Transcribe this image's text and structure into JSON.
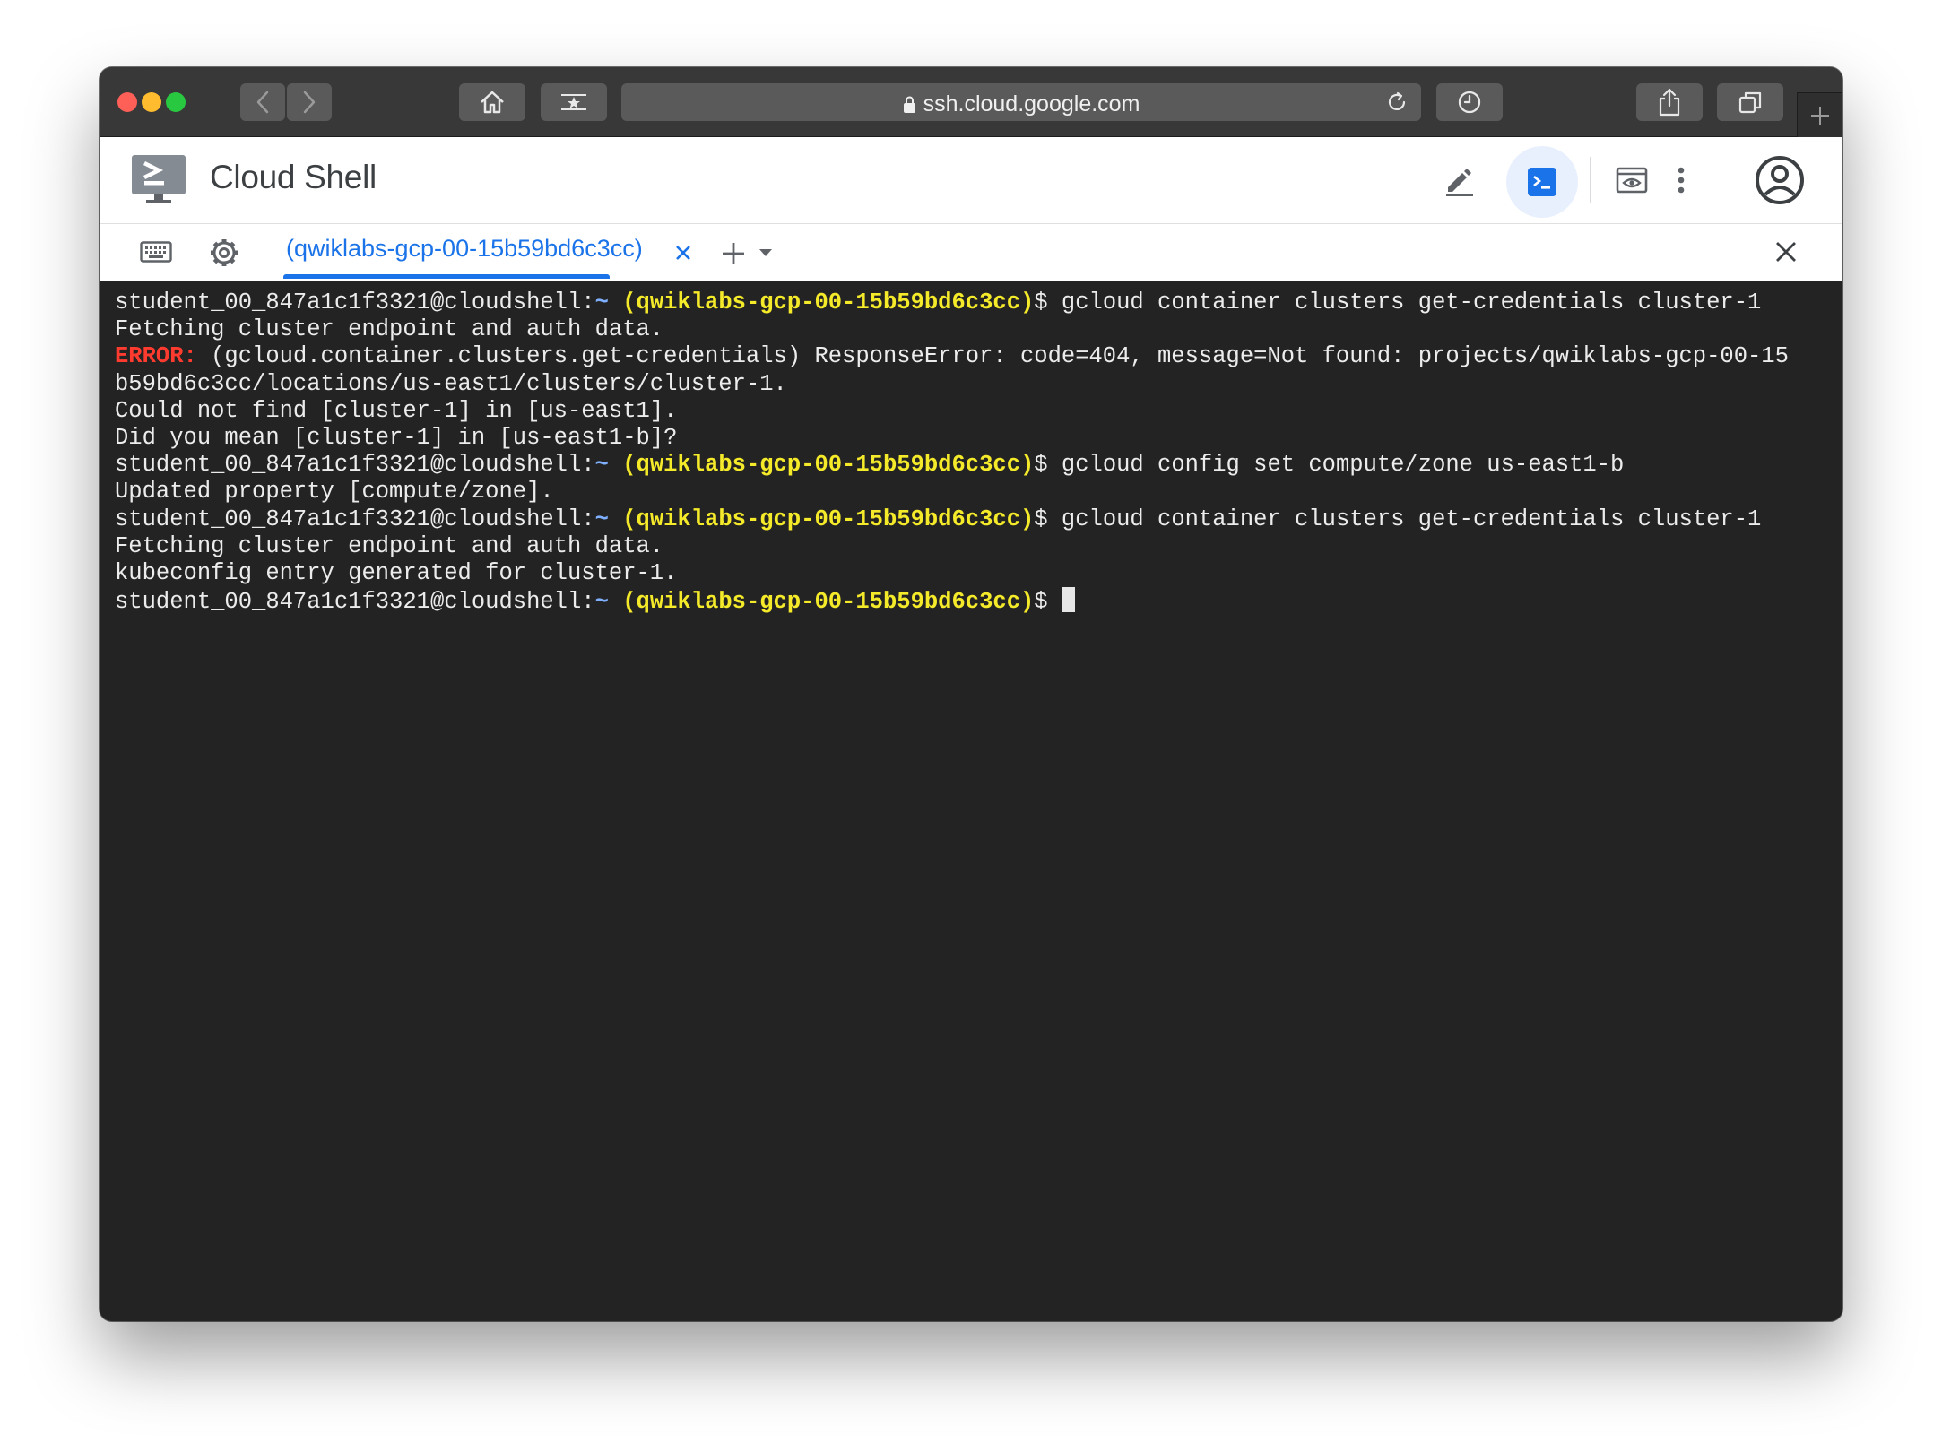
{
  "browser": {
    "url": "ssh.cloud.google.com",
    "traffic_lights": {
      "close": "#fe5f57",
      "minimize": "#febc2e",
      "zoom": "#28c840"
    }
  },
  "cloudshell": {
    "title": "Cloud Shell",
    "tab": {
      "label": "(qwiklabs-gcp-00-15b59bd6c3cc)"
    },
    "accent_color": "#1a73e8"
  },
  "terminal": {
    "prompt": {
      "user": "student_00_847a1c1f3321@cloudshell:",
      "path": "~",
      "project": "(qwiklabs-gcp-00-15b59bd6c3cc)",
      "symbol": "$"
    },
    "lines": [
      {
        "kind": "prompt",
        "command": " gcloud container clusters get-credentials cluster-1"
      },
      {
        "kind": "output",
        "text": "Fetching cluster endpoint and auth data."
      },
      {
        "kind": "error",
        "label": "ERROR:",
        "text": " (gcloud.container.clusters.get-credentials) ResponseError: code=404, message=Not found: projects/qwiklabs-gcp-00-15"
      },
      {
        "kind": "output",
        "text": "b59bd6c3cc/locations/us-east1/clusters/cluster-1."
      },
      {
        "kind": "output",
        "text": "Could not find [cluster-1] in [us-east1]."
      },
      {
        "kind": "output",
        "text": "Did you mean [cluster-1] in [us-east1-b]?"
      },
      {
        "kind": "prompt",
        "command": " gcloud config set compute/zone us-east1-b"
      },
      {
        "kind": "output",
        "text": "Updated property [compute/zone]."
      },
      {
        "kind": "prompt",
        "command": " gcloud container clusters get-credentials cluster-1"
      },
      {
        "kind": "output",
        "text": "Fetching cluster endpoint and auth data."
      },
      {
        "kind": "output",
        "text": "kubeconfig entry generated for cluster-1."
      },
      {
        "kind": "prompt",
        "command": " ",
        "cursor": true
      }
    ],
    "colors": {
      "background": "#232323",
      "text": "#ececec",
      "project": "#f4ea2a",
      "error": "#ff3b30",
      "path": "#7fb0ff"
    }
  }
}
